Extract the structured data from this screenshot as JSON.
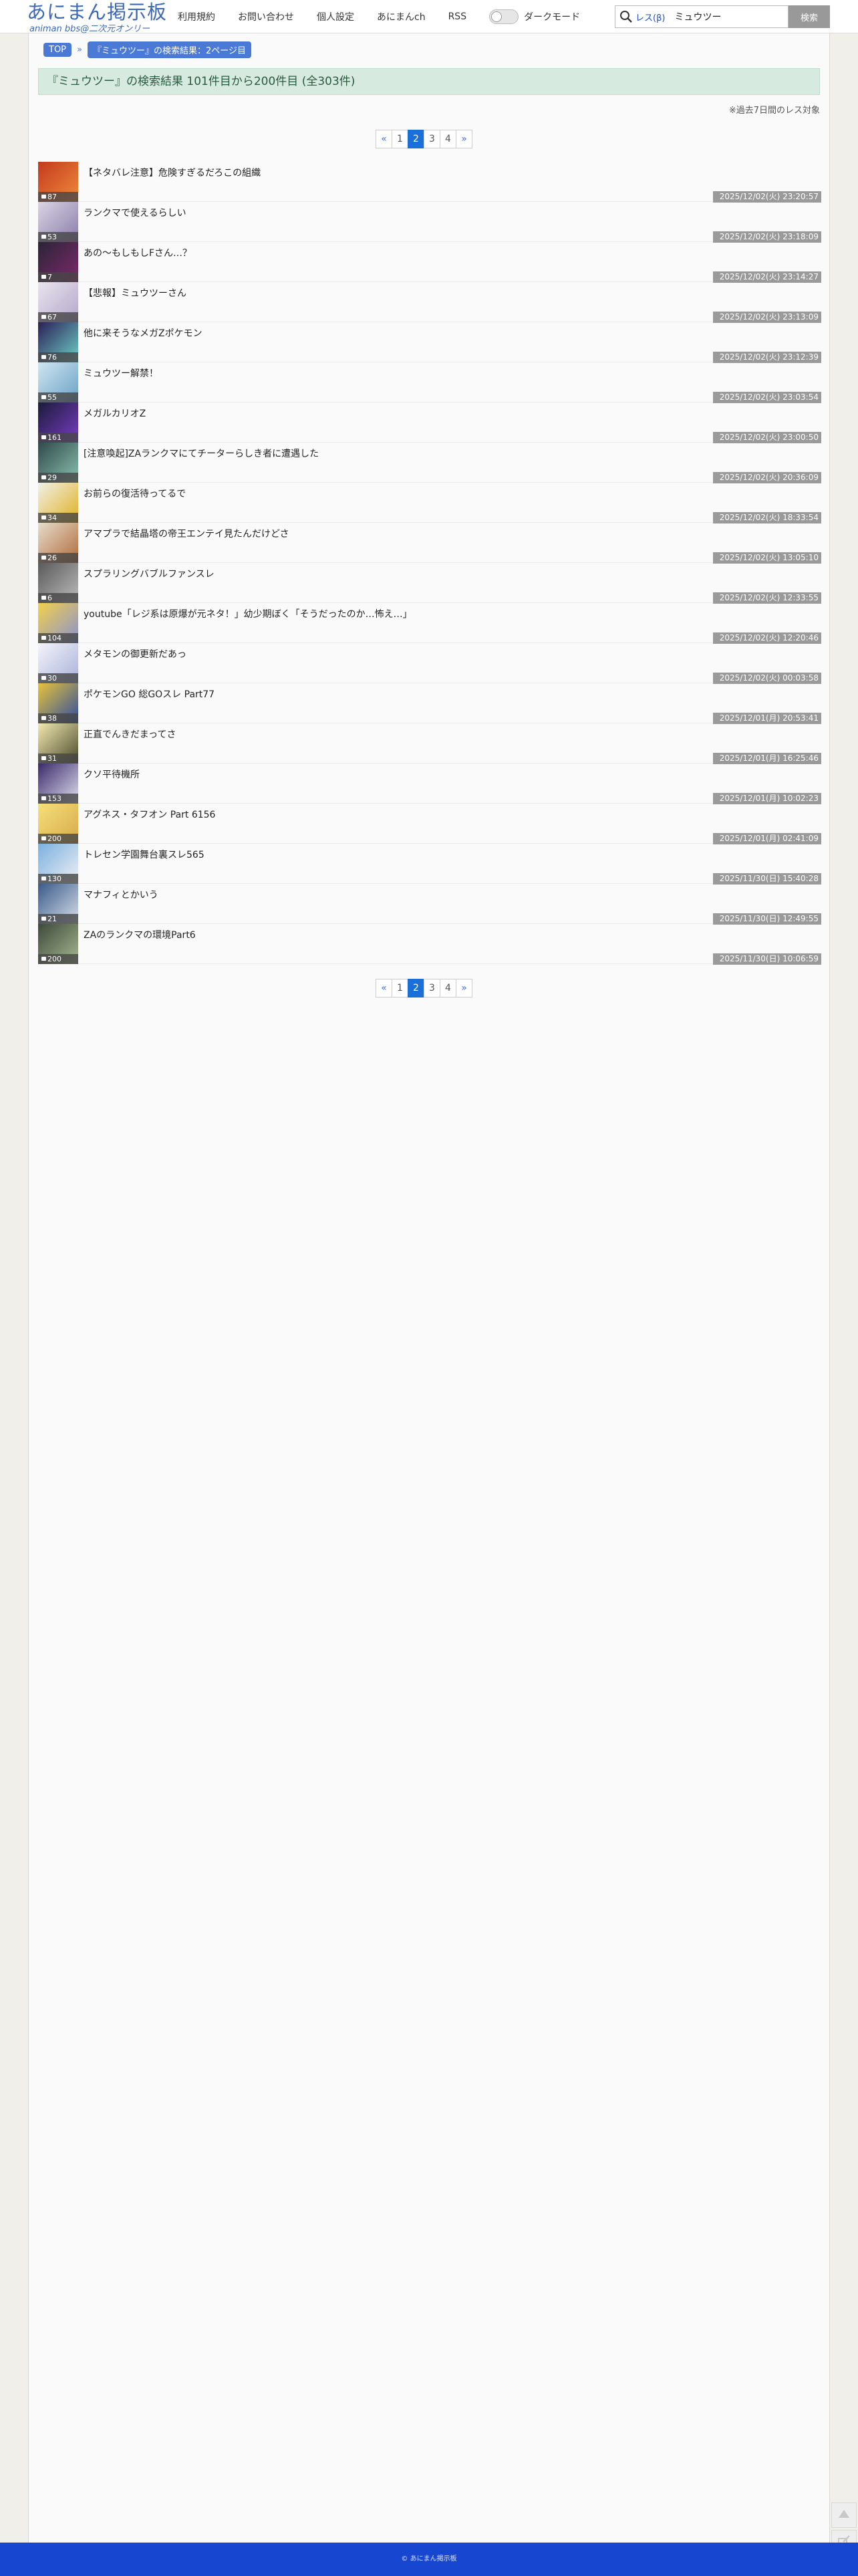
{
  "header": {
    "logo_title": "あにまん掲示板",
    "logo_sub": "animan bbs@二次元オンリー",
    "nav": [
      "利用規約",
      "お問い合わせ",
      "個人設定",
      "あにまんch",
      "RSS"
    ],
    "dark_mode_label": "ダークモード",
    "search_scope": "レス(β)",
    "search_value": "ミュウツー",
    "search_button": "検索"
  },
  "breadcrumb": [
    "TOP",
    "『ミュウツー』の検索結果：2ページ目"
  ],
  "breadcrumb_sep": "»",
  "result_banner": "『ミュウツー』の検索結果 101件目から200件目 (全303件)",
  "note": "※過去7日間のレス対象",
  "pager": {
    "prev": "«",
    "next": "»",
    "pages": [
      "1",
      "2",
      "3",
      "4"
    ],
    "current": "2"
  },
  "threads": [
    {
      "title": "【ネタバレ注意】危険すぎるだろこの組織",
      "count": "87",
      "date": "2025/12/02(火) 23:20:57"
    },
    {
      "title": "ランクマで使えるらしい",
      "count": "53",
      "date": "2025/12/02(火) 23:18:09"
    },
    {
      "title": "あの〜もしもしFさん…？",
      "count": "7",
      "date": "2025/12/02(火) 23:14:27"
    },
    {
      "title": "【悲報】ミュウツーさん",
      "count": "67",
      "date": "2025/12/02(火) 23:13:09"
    },
    {
      "title": "他に来そうなメガZポケモン",
      "count": "76",
      "date": "2025/12/02(火) 23:12:39"
    },
    {
      "title": "ミュウツー解禁！",
      "count": "55",
      "date": "2025/12/02(火) 23:03:54"
    },
    {
      "title": "メガルカリオZ",
      "count": "161",
      "date": "2025/12/02(火) 23:00:50"
    },
    {
      "title": "[注意喚起]ZAランクマにてチーターらしき者に遭遇した",
      "count": "29",
      "date": "2025/12/02(火) 20:36:09"
    },
    {
      "title": "お前らの復活待ってるで",
      "count": "34",
      "date": "2025/12/02(火) 18:33:54"
    },
    {
      "title": "アマプラで結晶塔の帝王エンテイ見たんだけどさ",
      "count": "26",
      "date": "2025/12/02(火) 13:05:10"
    },
    {
      "title": "スプラリングバブルファンスレ",
      "count": "6",
      "date": "2025/12/02(火) 12:33:55"
    },
    {
      "title": "youtube「レジ系は原爆が元ネタ！」幼少期ぼく「そうだったのか…怖え…」",
      "count": "104",
      "date": "2025/12/02(火) 12:20:46"
    },
    {
      "title": "メタモンの御更新だあっ",
      "count": "30",
      "date": "2025/12/02(火) 00:03:58"
    },
    {
      "title": "ポケモンGO 総GOスレ Part77",
      "count": "38",
      "date": "2025/12/01(月) 20:53:41"
    },
    {
      "title": "正直でんきだまってさ",
      "count": "31",
      "date": "2025/12/01(月) 16:25:46"
    },
    {
      "title": "クソ平待機所",
      "count": "153",
      "date": "2025/12/01(月) 10:02:23"
    },
    {
      "title": "アグネス・タフオン Part 6156",
      "count": "200",
      "date": "2025/12/01(月) 02:41:09"
    },
    {
      "title": "トレセン学園舞台裏スレ565",
      "count": "130",
      "date": "2025/11/30(日) 15:40:28"
    },
    {
      "title": "マナフィとかいう",
      "count": "21",
      "date": "2025/11/30(日) 12:49:55"
    },
    {
      "title": "ZAのランクマの環境Part6",
      "count": "200",
      "date": "2025/11/30(日) 10:06:59"
    }
  ],
  "thumb_colors": [
    [
      "#c33a1f",
      "#f08a3a"
    ],
    [
      "#d9d4e4",
      "#8a7ca8"
    ],
    [
      "#2b2438",
      "#7d2a6a"
    ],
    [
      "#e8e4ee",
      "#b3a6c9"
    ],
    [
      "#2a1f55",
      "#6fd0c9"
    ],
    [
      "#cfe6f2",
      "#6aa0c4"
    ],
    [
      "#1a1c3a",
      "#7a3cc4"
    ],
    [
      "#2f4a4a",
      "#8cc0b0"
    ],
    [
      "#f0f0e8",
      "#e0b020"
    ],
    [
      "#e6dccb",
      "#b06a3a"
    ],
    [
      "#5a5a5a",
      "#bcbcbc"
    ],
    [
      "#f2d24a",
      "#8a8fd0"
    ],
    [
      "#f4f4fa",
      "#a8b0d8"
    ],
    [
      "#e8c23a",
      "#2c4ca0"
    ],
    [
      "#f2e8b0",
      "#4a4a2a"
    ],
    [
      "#3a2a6a",
      "#e0e0f0"
    ],
    [
      "#f4e07a",
      "#d8a84a"
    ],
    [
      "#7ab0e0",
      "#f0f0f4"
    ],
    [
      "#3a5a8a",
      "#d8e0ea"
    ],
    [
      "#3c4a3a",
      "#a8b890"
    ]
  ],
  "footer": "© あにまん掲示板"
}
